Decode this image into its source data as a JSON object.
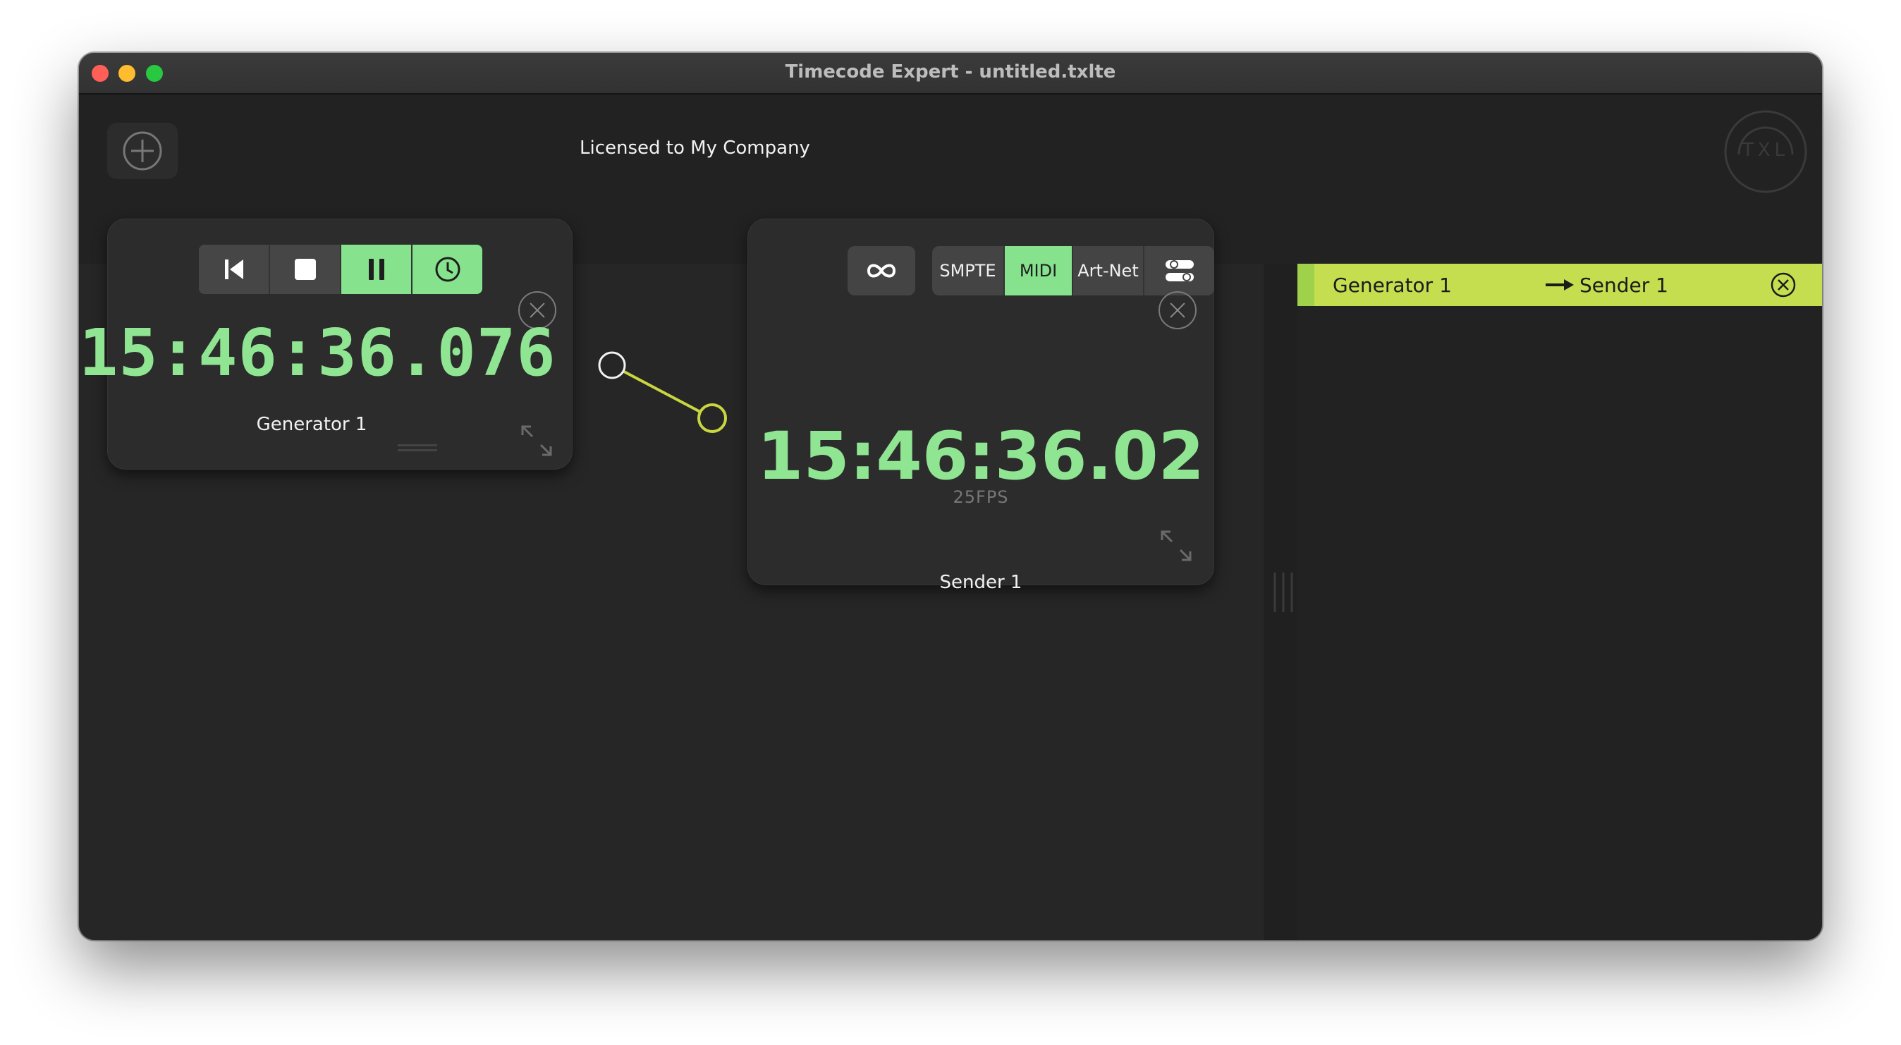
{
  "window": {
    "title": "Timecode Expert - untitled.txlte"
  },
  "header": {
    "add_icon": "plus-circle-icon",
    "license_text": "Licensed to My Company",
    "logo_text": "TXL"
  },
  "generator": {
    "label": "Generator 1",
    "timecode": "15:46:36.076",
    "transport": [
      {
        "icon": "skip-back-icon",
        "active": false
      },
      {
        "icon": "stop-icon",
        "active": false
      },
      {
        "icon": "pause-icon",
        "active": true
      },
      {
        "icon": "clock-icon",
        "active": true
      }
    ]
  },
  "sender": {
    "label": "Sender 1",
    "timecode": "15:46:36.02",
    "fps": "25FPS",
    "loop_icon": "infinity-icon",
    "protocols": [
      {
        "label": "SMPTE",
        "active": false
      },
      {
        "label": "MIDI",
        "active": true
      },
      {
        "label": "Art-Net",
        "active": false
      }
    ],
    "settings_icon": "toggles-icon"
  },
  "routes": [
    {
      "source": "Generator 1",
      "target": "Sender 1"
    }
  ],
  "colors": {
    "accent_green": "#86e28d",
    "timecode_green": "#8fe592",
    "route_bar": "#c4de4f",
    "wire": "#c9d640"
  }
}
